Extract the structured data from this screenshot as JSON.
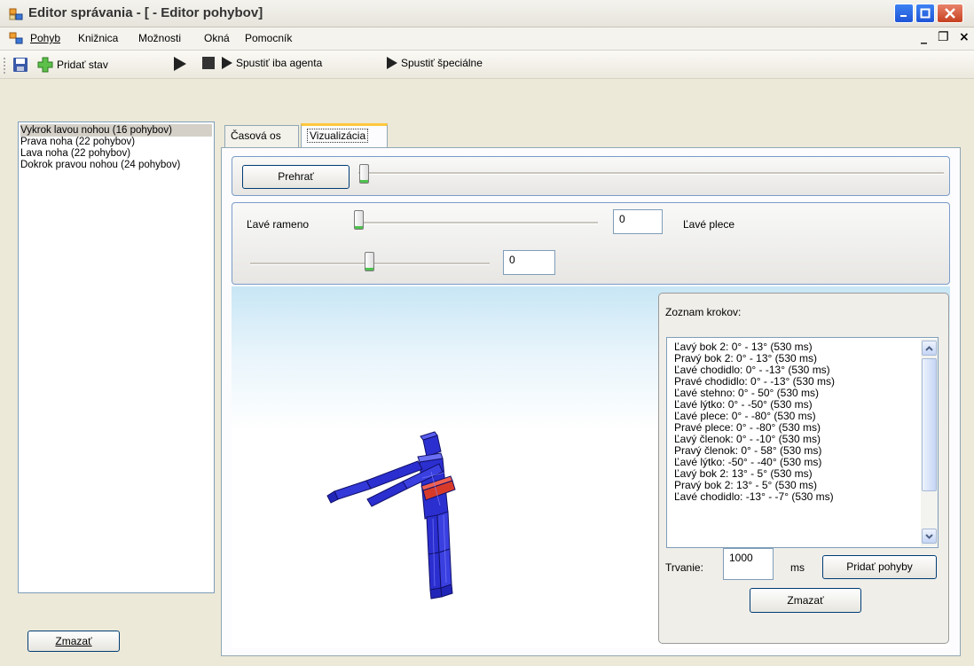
{
  "window": {
    "title": "Editor správania - [ - Editor pohybov]"
  },
  "menu": {
    "items": [
      "Pohyb",
      "Knižnica",
      "Možnosti",
      "Okná",
      "Pomocník"
    ],
    "mdi_min": "_",
    "mdi_restore": "❐",
    "mdi_close": "×"
  },
  "toolbar": {
    "add_state_label": "Pridať stav",
    "run_agent_label": "Spustiť iba agenta",
    "run_special_label": "Spustiť špeciálne"
  },
  "motions": {
    "items": [
      "Vykrok lavou nohou (16 pohybov)",
      "Prava noha (22 pohybov)",
      "Lava noha (22 pohybov)",
      "Dokrok pravou nohou (24 pohybov)"
    ],
    "selected_index": 0,
    "delete_label": "Zmazať"
  },
  "tabs": {
    "timeline": "Časová os",
    "visualization": "Vizualizácia",
    "active": "Vizualizácia"
  },
  "playback": {
    "play_label": "Prehrať",
    "position": 0
  },
  "joints": {
    "left_arm_label": "Ľavé rameno",
    "left_arm_value": "0",
    "left_arm_slider": 0,
    "left_shoulder_label": "Ľavé plece",
    "left_shoulder_value": "0",
    "left_shoulder_slider": 0.5
  },
  "steps": {
    "title": "Zoznam krokov:",
    "items": [
      "Ľavý bok 2: 0° - 13° (530 ms)",
      "Pravý bok 2: 0° - 13° (530 ms)",
      "Ľavé chodidlo: 0° - -13° (530 ms)",
      "Pravé chodidlo: 0° - -13° (530 ms)",
      "Ľavé stehno: 0° - 50° (530 ms)",
      "Ľavé lýtko: 0° - -50° (530 ms)",
      "Ľavé plece: 0° - -80° (530 ms)",
      "Pravé plece: 0° - -80° (530 ms)",
      "Ľavý členok: 0° - -10° (530 ms)",
      "Pravý členok: 0° - 58° (530 ms)",
      "Ľavé lýtko: -50° - -40° (530 ms)",
      "Ľavý bok 2: 13° - 5° (530 ms)",
      "Pravý bok 2: 13° - 5° (530 ms)",
      "Ľavé chodidlo: -13° - -7° (530 ms)"
    ],
    "duration_label": "Trvanie:",
    "duration_value": "1000",
    "duration_unit": "ms",
    "add_motions_label": "Pridať pohyby",
    "delete_label": "Zmazať"
  },
  "colors": {
    "robot_body": "#2b2fd0",
    "robot_highlight": "#d83a2a",
    "accent_tab": "#ffc83c"
  }
}
